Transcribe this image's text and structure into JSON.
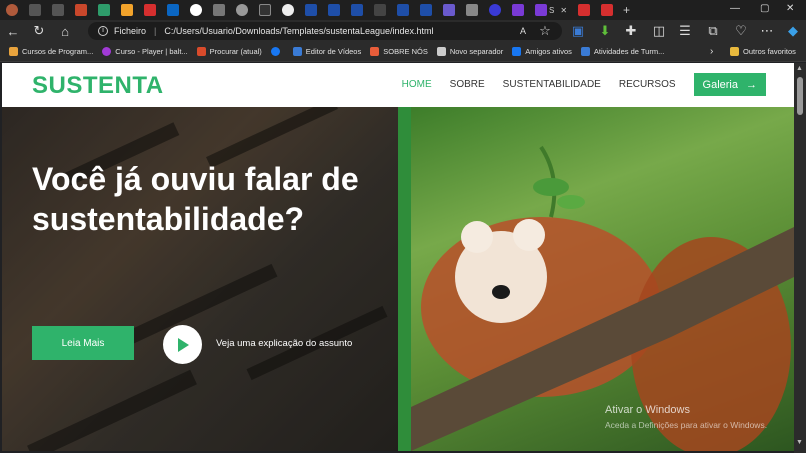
{
  "browser": {
    "active_tab_label": "S",
    "address": {
      "protocol_label": "Ficheiro",
      "url": "C:/Users/Usuario/Downloads/Templates/sustentaLeague/index.html"
    },
    "bookmarks": [
      {
        "label": "Cursos de Program...",
        "color": "#e8a33d"
      },
      {
        "label": "Curso - Player | balt...",
        "color": "#a13ad6"
      },
      {
        "label": "Procurar (atual)",
        "color": "#d94b2b"
      },
      {
        "label": "",
        "color": "#1877f2"
      },
      {
        "label": "Editor de Vídeos",
        "color": "#3a7bd5"
      },
      {
        "label": "SOBRE NÓS",
        "color": "#e85d3a"
      },
      {
        "label": "Novo separador",
        "color": "#cccccc"
      },
      {
        "label": "Amigos ativos",
        "color": "#1877f2"
      },
      {
        "label": "Atividades de Turm...",
        "color": "#3a7bd5"
      }
    ],
    "other_bookmarks_label": "Outros favoritos"
  },
  "site": {
    "logo": "SUSTENTA",
    "nav": {
      "home": "HOME",
      "sobre": "SOBRE",
      "sustentabilidade": "SUSTENTABILIDADE",
      "recursos": "RECURSOS",
      "galeria": "Galeria"
    },
    "hero": {
      "title": "Você já ouviu falar de sustentabilidade?",
      "primary_button": "Leia Mais",
      "video_label": "Veja uma explicação do assunto"
    }
  },
  "os": {
    "activation_title": "Ativar o Windows",
    "activation_subtitle": "Aceda a Definições para ativar o Windows."
  },
  "colors": {
    "accent": "#2fb36b"
  }
}
